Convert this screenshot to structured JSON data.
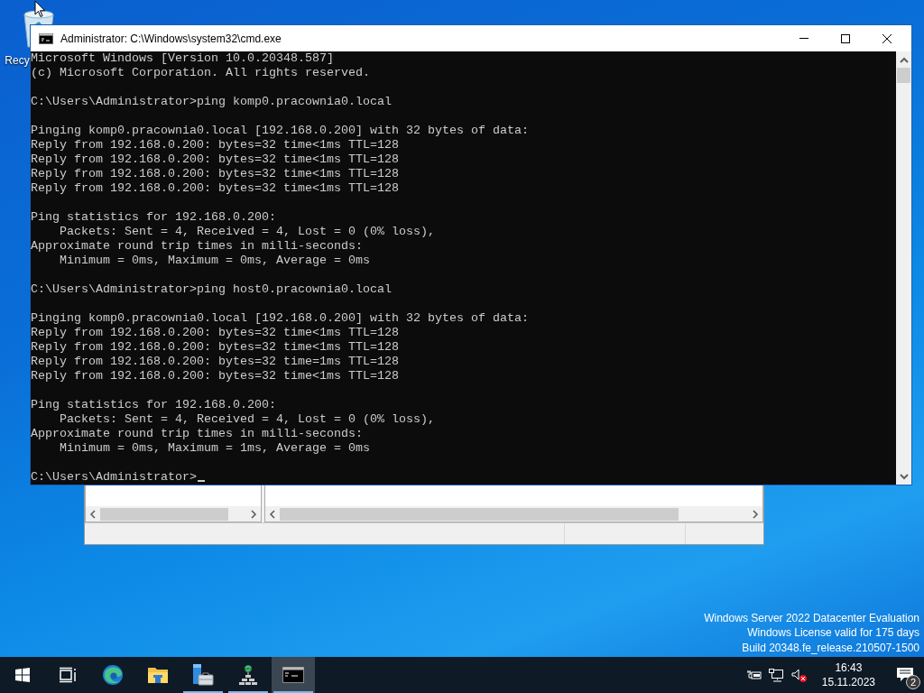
{
  "desktop_icons": [
    {
      "label": "Recy"
    }
  ],
  "console_window": {
    "title": "Administrator: C:\\Windows\\system32\\cmd.exe",
    "blocks": [
      [
        "Microsoft Windows [Version 10.0.20348.587]",
        "(c) Microsoft Corporation. All rights reserved."
      ],
      [
        "C:\\Users\\Administrator>ping komp0.pracownia0.local"
      ],
      [
        "Pinging komp0.pracownia0.local [192.168.0.200] with 32 bytes of data:",
        "Reply from 192.168.0.200: bytes=32 time<1ms TTL=128",
        "Reply from 192.168.0.200: bytes=32 time<1ms TTL=128",
        "Reply from 192.168.0.200: bytes=32 time<1ms TTL=128",
        "Reply from 192.168.0.200: bytes=32 time<1ms TTL=128"
      ],
      [
        "Ping statistics for 192.168.0.200:",
        "    Packets: Sent = 4, Received = 4, Lost = 0 (0% loss),",
        "Approximate round trip times in milli-seconds:",
        "    Minimum = 0ms, Maximum = 0ms, Average = 0ms"
      ],
      [
        "C:\\Users\\Administrator>ping host0.pracownia0.local"
      ],
      [
        "Pinging komp0.pracownia0.local [192.168.0.200] with 32 bytes of data:",
        "Reply from 192.168.0.200: bytes=32 time<1ms TTL=128",
        "Reply from 192.168.0.200: bytes=32 time<1ms TTL=128",
        "Reply from 192.168.0.200: bytes=32 time=1ms TTL=128",
        "Reply from 192.168.0.200: bytes=32 time<1ms TTL=128"
      ],
      [
        "Ping statistics for 192.168.0.200:",
        "    Packets: Sent = 4, Received = 4, Lost = 0 (0% loss),",
        "Approximate round trip times in milli-seconds:",
        "    Minimum = 0ms, Maximum = 1ms, Average = 0ms"
      ],
      [
        "C:\\Users\\Administrator>"
      ]
    ]
  },
  "watermark": [
    "Windows Server 2022 Datacenter Evaluation",
    "Windows License valid for 175 days",
    "Build 20348.fe_release.210507-1500"
  ],
  "taskbar": {
    "apps": [
      {
        "kind": "taskview",
        "running": false,
        "active": false
      },
      {
        "kind": "edge",
        "running": false,
        "active": false
      },
      {
        "kind": "explorer",
        "running": false,
        "active": false
      },
      {
        "kind": "servermanager",
        "running": true,
        "active": false
      },
      {
        "kind": "network",
        "running": true,
        "active": false
      },
      {
        "kind": "console",
        "running": true,
        "active": true
      }
    ],
    "time": "16:43",
    "date": "15.11.2023",
    "notification_count": "2"
  }
}
